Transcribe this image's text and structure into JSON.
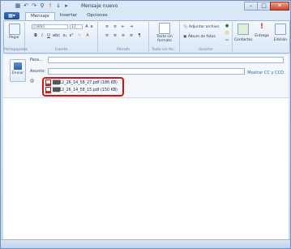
{
  "window": {
    "title": "Mensaje nuevo",
    "controls": {
      "minimize": "–",
      "maximize": "□",
      "close": "✕"
    }
  },
  "quick_access": [
    "save-icon",
    "undo-icon",
    "redo-icon",
    "attach-icon",
    "priority-icon",
    "down-arrow-icon",
    "send-icon"
  ],
  "tabs": [
    {
      "label": "Mensaje",
      "active": true
    },
    {
      "label": "Insertar",
      "active": false
    },
    {
      "label": "Opciones",
      "active": false
    }
  ],
  "ribbon": {
    "clipboard": {
      "paste": "Pegar",
      "label": "Portapapeles"
    },
    "font": {
      "family": "Calibri",
      "size": "12",
      "label": "Fuente"
    },
    "paragraph": {
      "label": "Párrafo"
    },
    "plaintext": {
      "button": "Texto sin formato",
      "label": "Texto sin for..."
    },
    "insert": {
      "attach": "Adjuntar archivo",
      "album": "Álbum de fotos",
      "label": "Insertar"
    },
    "contacts": {
      "label": "Contactos"
    },
    "delivery": {
      "label": "Entrega"
    },
    "editing": {
      "label": "Edición"
    }
  },
  "compose": {
    "send_label": "Enviar",
    "to_label": "Para...",
    "to_value": "",
    "subject_label": "Asunto:",
    "subject_value": "",
    "show_cc": "Mostrar CC y CCO",
    "attachments_label": "@",
    "attachments": [
      {
        "name": "12_26_14_58_27.pdf (186 KB)",
        "prefix": "███"
      },
      {
        "name": "12_26_14_58_15.pdf (150 KB)",
        "prefix": "███"
      }
    ]
  },
  "colors": {
    "highlight": "#d41515",
    "accent": "#2b5db5"
  }
}
